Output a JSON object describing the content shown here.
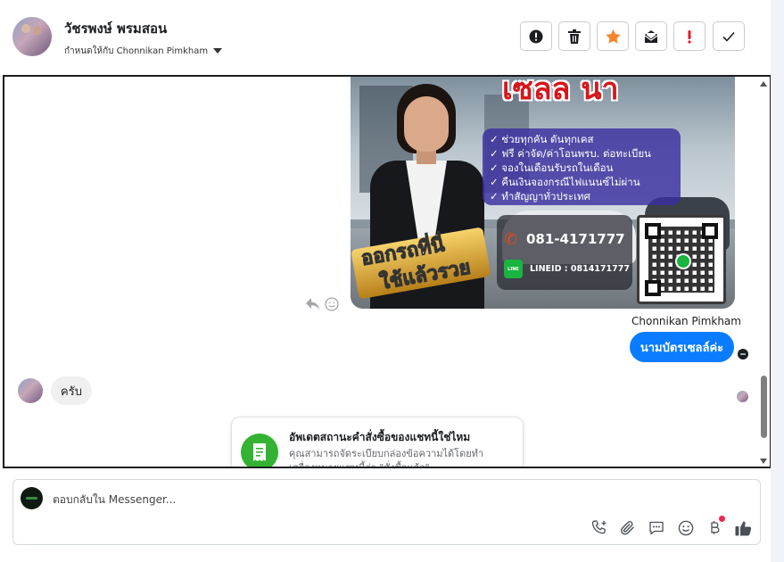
{
  "header": {
    "contact_name": "วัชรพงษ์ พรมสอน",
    "assigned_label": "กำหนดให้กับ Chonnikan Pimkham",
    "actions": [
      {
        "icon": "alert-circle-icon"
      },
      {
        "icon": "trash-icon"
      },
      {
        "icon": "star-icon",
        "color": "#f5862c"
      },
      {
        "icon": "mail-icon"
      },
      {
        "icon": "exclamation-icon",
        "color": "#e4182b"
      },
      {
        "icon": "check-icon"
      }
    ]
  },
  "card": {
    "headline": "เซลล นา",
    "benefits": [
      "✓ ช่วยทุกคัน ดันทุกเคส",
      "✓ ฟรี ค่าจัด/ค่าโอนพรบ. ต่อทะเบียน",
      "✓ จองในเดือนรับรถในเดือน",
      "✓ คืนเงินจองกรณีไฟแนนซ์ไม่ผ่าน",
      "✓ ทำสัญญาทั่วประเทศ"
    ],
    "phone": "081-4171777",
    "line_logo": "LINE",
    "line_id": "LINEID : 0814171777",
    "banner_line1": "ออกรถที่นี่",
    "banner_line2": "ใช้แล้วรวย"
  },
  "messages": {
    "sender_name": "Chonnikan Pimkham",
    "outgoing_text": "นามบัตรเซลล์ค่ะ",
    "incoming_text": "ครับ"
  },
  "suggestion": {
    "title": "อัพเดตสถานะคำสั่งซื้อของแชทนี้ใช่ไหม",
    "body": "คุณสามารถจัดระเบียบกล่องข้อความได้โดยทำเครื่องหมายแชทนี้ว่า \"สั่งซื้อแล้ว\""
  },
  "composer": {
    "placeholder": "ตอบกลับใน Messenger...",
    "tools": [
      "phone-add-icon",
      "paperclip-icon",
      "chat-bubble-icon",
      "smiley-icon",
      "baht-icon",
      "thumbs-up-icon"
    ]
  },
  "colors": {
    "messenger_blue": "#0a7cff",
    "suggest_green": "#34b233",
    "star_orange": "#f5862c",
    "alert_red": "#e4182b"
  }
}
